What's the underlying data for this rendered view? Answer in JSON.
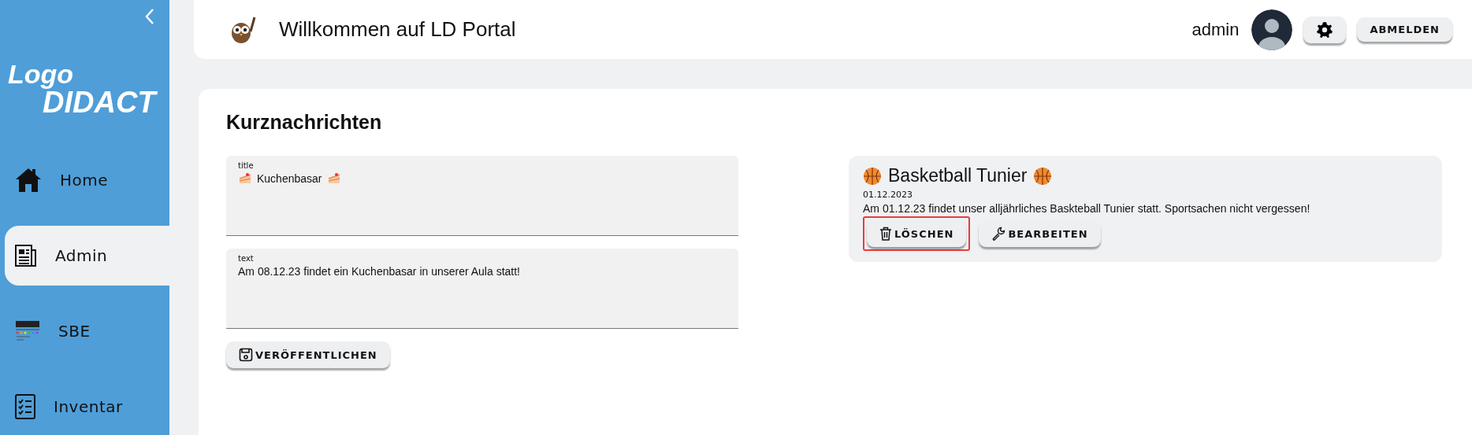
{
  "sidebar": {
    "logo": {
      "line1": "Logo",
      "line2": "DIDACT"
    },
    "items": [
      {
        "label": "Home",
        "kind": "home",
        "selected": false
      },
      {
        "label": "Admin",
        "kind": "news",
        "selected": true
      },
      {
        "label": "SBE",
        "kind": "sbe",
        "selected": false
      },
      {
        "label": "Inventar",
        "kind": "list",
        "selected": false
      }
    ]
  },
  "header": {
    "title": "Willkommen auf LD Portal",
    "user": "admin",
    "logout": "ABMELDEN"
  },
  "content": {
    "heading": "Kurznachrichten",
    "fields": [
      {
        "label": "title",
        "value": "Kuchenbasar"
      },
      {
        "label": "text",
        "value": "Am 08.12.23 findet ein Kuchenbasar in unserer Aula statt!"
      }
    ],
    "publish": "VERÖFFENTLICHEN",
    "news": {
      "title": "Basketball Tunier",
      "date": "01.12.2023",
      "text": "Am 01.12.23 findet unser alljährliches Baskteball Tunier statt. Sportsachen nicht vergessen!",
      "buttons": [
        {
          "label": "LÖSCHEN",
          "kind": "delete",
          "highlighted": true
        },
        {
          "label": "BEARBEITEN",
          "kind": "edit",
          "highlighted": false
        }
      ]
    }
  }
}
